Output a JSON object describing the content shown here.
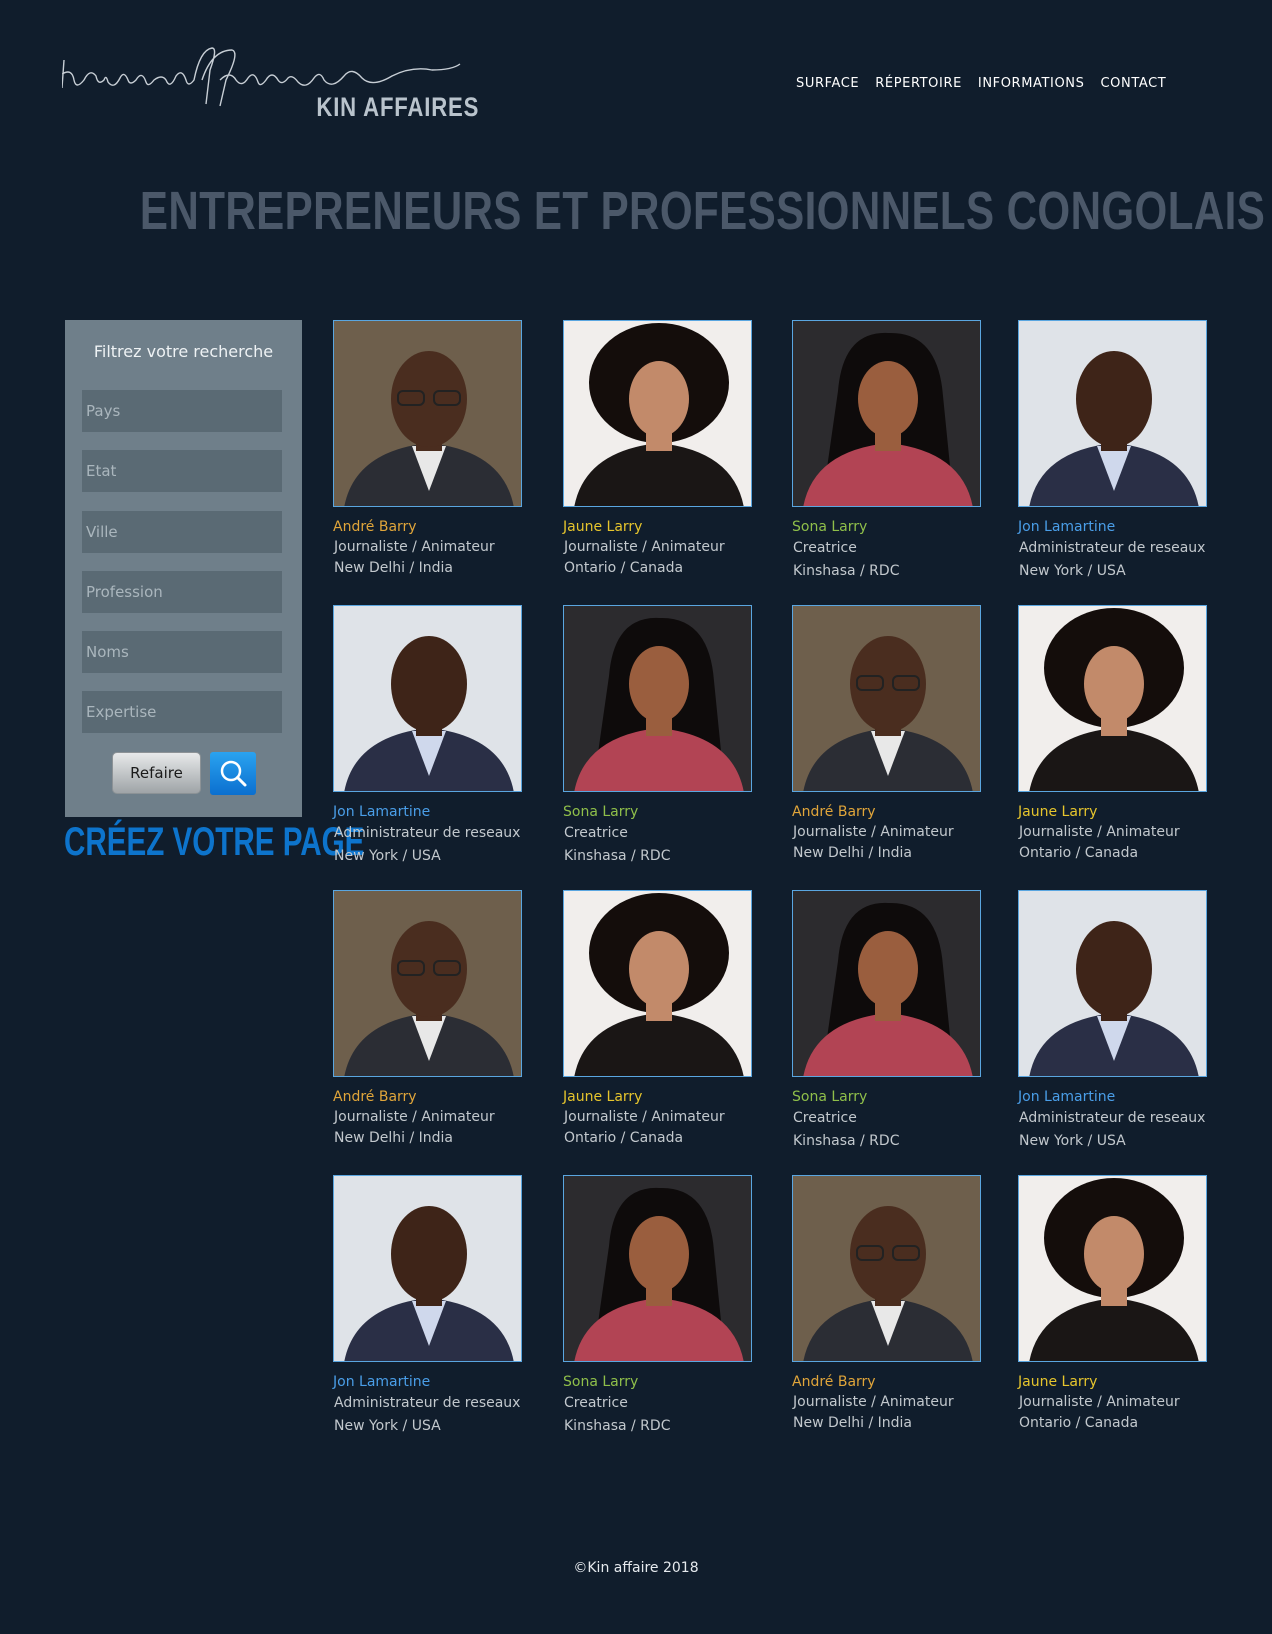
{
  "brand": {
    "logo_script": "kinaffaires",
    "logo_text": "KIN AFFAIRES"
  },
  "nav": {
    "items": [
      "SURFACE",
      "RÉPERTOIRE",
      "INFORMATIONS",
      "CONTACT"
    ]
  },
  "page_title": "ENTREPRENEURS ET PROFESSIONNELS CONGOLAIS",
  "filter": {
    "title": "Filtrez votre recherche",
    "fields": [
      "Pays",
      "Etat",
      "Ville",
      "Profession",
      "Noms",
      "Expertise"
    ],
    "reset_label": "Refaire",
    "search_icon": "search-icon"
  },
  "create_page_label": "CRÉEZ VOTRE PAGE",
  "people": {
    "andre": {
      "name": "André Barry",
      "role": "Journaliste / Animateur",
      "location": "New Delhi / India",
      "name_color": "#e0a53a"
    },
    "jaune": {
      "name": "Jaune Larry",
      "role": "Journaliste / Animateur",
      "location": "Ontario / Canada",
      "name_color": "#e6c52d"
    },
    "sona": {
      "name": "Sona Larry",
      "role": "Creatrice",
      "location": "Kinshasa / RDC",
      "name_color": "#8fbf4a"
    },
    "jon": {
      "name": "Jon Lamartine",
      "role": "Administrateur  de reseaux",
      "location": "New York / USA",
      "name_color": "#4a9ee8"
    }
  },
  "grid": [
    [
      "andre",
      "jaune",
      "sona",
      "jon"
    ],
    [
      "jon",
      "sona",
      "andre",
      "jaune"
    ],
    [
      "andre",
      "jaune",
      "sona",
      "jon"
    ],
    [
      "jon",
      "sona",
      "andre",
      "jaune"
    ]
  ],
  "footer": "©Kin affaire 2018"
}
